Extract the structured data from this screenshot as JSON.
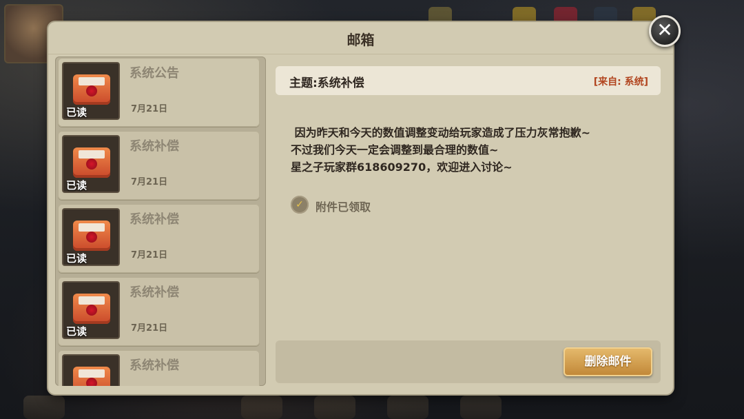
{
  "window": {
    "title": "邮箱",
    "close_glyph": "✕"
  },
  "mail_list": [
    {
      "title": "系统公告",
      "date": "7月21日",
      "status": "已读",
      "icon": "envelope-icon",
      "selected": true
    },
    {
      "title": "系统补偿",
      "date": "7月21日",
      "status": "已读",
      "icon": "envelope-icon"
    },
    {
      "title": "系统补偿",
      "date": "7月21日",
      "status": "已读",
      "icon": "envelope-icon"
    },
    {
      "title": "系统补偿",
      "date": "7月21日",
      "status": "已读",
      "icon": "envelope-icon"
    },
    {
      "title": "系统补偿",
      "date": "",
      "status": "",
      "icon": "envelope-icon"
    }
  ],
  "detail": {
    "subject": "主题:系统补偿",
    "from": "[来自: 系统]",
    "body": " 因为昨天和今天的数值调整变动给玩家造成了压力灰常抱歉~\n不过我们今天一定会调整到最合理的数值~\n星之子玩家群618609270，欢迎进入讨论~",
    "attachment_status": "附件已领取",
    "attachment_icon": "check-icon"
  },
  "actions": {
    "delete_label": "删除邮件"
  },
  "colors": {
    "panel": "#d2cbb2",
    "accent_button": "#d49e4f",
    "from_text": "#b1441e"
  }
}
